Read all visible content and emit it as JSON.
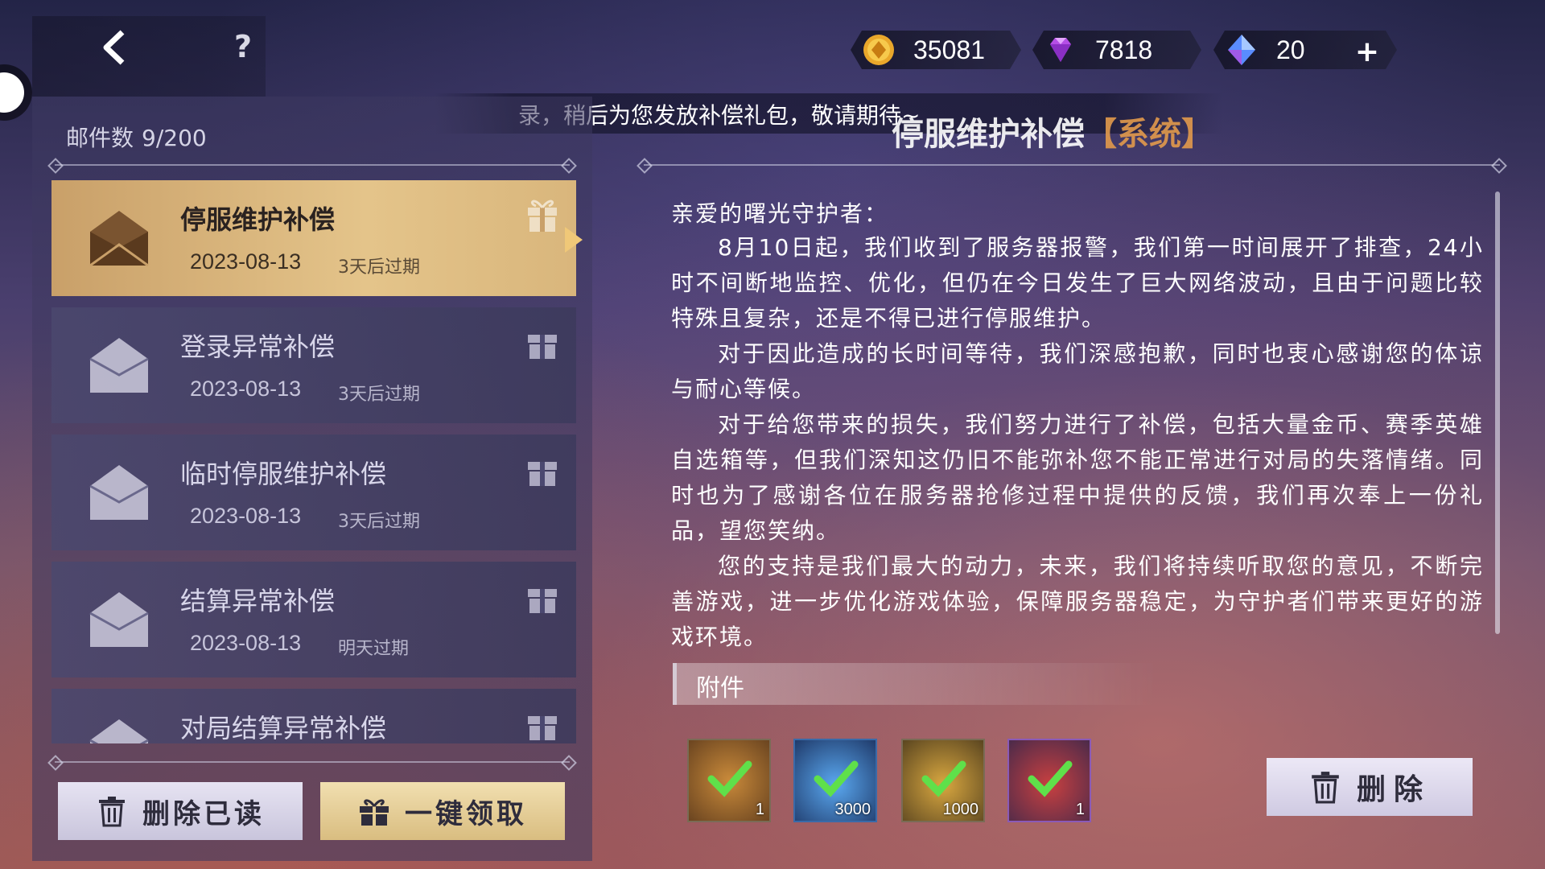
{
  "topbar": {
    "help_label": "?",
    "currencies": [
      {
        "name": "gold-coin",
        "value": "35081"
      },
      {
        "name": "purple-diamond",
        "value": "7818"
      },
      {
        "name": "blue-crystal",
        "value": "20"
      }
    ],
    "plus_label": "+"
  },
  "marquee": {
    "text": "录，稍后为您发放补偿礼包，敬请期待~"
  },
  "mailbox": {
    "count_label": "邮件数",
    "count_value": "9/200",
    "items": [
      {
        "title": "停服维护补偿",
        "date": "2023-08-13",
        "expire": "3天后过期"
      },
      {
        "title": "登录异常补偿",
        "date": "2023-08-13",
        "expire": "3天后过期"
      },
      {
        "title": "临时停服维护补偿",
        "date": "2023-08-13",
        "expire": "3天后过期"
      },
      {
        "title": "结算异常补偿",
        "date": "2023-08-13",
        "expire": "明天过期"
      },
      {
        "title": "对局结算异常补偿",
        "date": "",
        "expire": ""
      }
    ],
    "delete_read_label": "删除已读",
    "claim_all_label": "一键领取"
  },
  "mail": {
    "title": "停服维护补偿",
    "sender": "【系统】",
    "greeting": "亲爱的曙光守护者：",
    "paragraphs": [
      "8月10日起，我们收到了服务器报警，我们第一时间展开了排查，24小时不间断地监控、优化，但仍在今日发生了巨大网络波动，且由于问题比较特殊且复杂，还是不得已进行停服维护。",
      "对于因此造成的长时间等待，我们深感抱歉，同时也衷心感谢您的体谅与耐心等候。",
      "对于给您带来的损失，我们努力进行了补偿，包括大量金币、赛季英雄自选箱等，但我们深知这仍旧不能弥补您不能正常进行对局的失落情绪。同时也为了感谢各位在服务器抢修过程中提供的反馈，我们再次奉上一份礼品，望您笑纳。",
      "您的支持是我们最大的动力，未来，我们将持续听取您的意见，不断完善游戏，进一步优化游戏体验，保障服务器稳定，为守护者们带来更好的游戏环境。"
    ],
    "attachment_label": "附件",
    "attachments": [
      {
        "name": "skin-box",
        "qty": "1",
        "color": "#8a5a2a"
      },
      {
        "name": "blue-crystal-pile",
        "qty": "3000",
        "color": "#1f3a6a"
      },
      {
        "name": "gold-pile",
        "qty": "1000",
        "color": "#5a4520"
      },
      {
        "name": "red-card",
        "qty": "1",
        "color": "#4a2a4a"
      }
    ],
    "delete_label": "删除"
  }
}
